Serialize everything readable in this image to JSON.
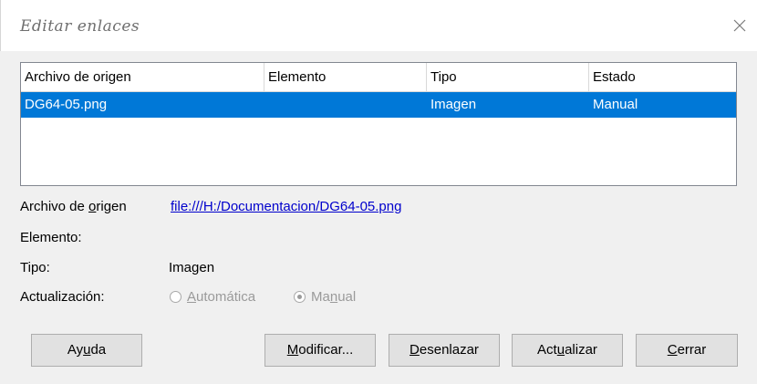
{
  "dialog": {
    "title": "Editar enlaces"
  },
  "table": {
    "headers": [
      "Archivo de origen",
      "Elemento",
      "Tipo",
      "Estado"
    ],
    "rows": [
      {
        "archivo": "DG64-05.png",
        "elemento": "",
        "tipo": "Imagen",
        "estado": "Manual"
      }
    ]
  },
  "details": {
    "source_label_pre": "Archivo de ",
    "source_label_key": "o",
    "source_label_post": "rigen",
    "source_link": "file:///H:/Documentacion/DG64-05.png",
    "element_label": "Elemento:",
    "type_label": "Tipo:",
    "type_value": "Imagen",
    "update_label": "Actualización:",
    "auto_key": "A",
    "auto_rest": "utomática",
    "manual_pre": "Ma",
    "manual_key": "n",
    "manual_post": "ual",
    "selected_update": "Manual"
  },
  "buttons": {
    "help": {
      "pre": "Ay",
      "key": "u",
      "post": "da"
    },
    "modify": {
      "pre": "",
      "key": "M",
      "post": "odificar..."
    },
    "unlink": {
      "pre": "",
      "key": "D",
      "post": "esenlazar"
    },
    "update": {
      "pre": "Act",
      "key": "u",
      "post": "alizar"
    },
    "close": {
      "pre": "",
      "key": "C",
      "post": "errar"
    }
  }
}
